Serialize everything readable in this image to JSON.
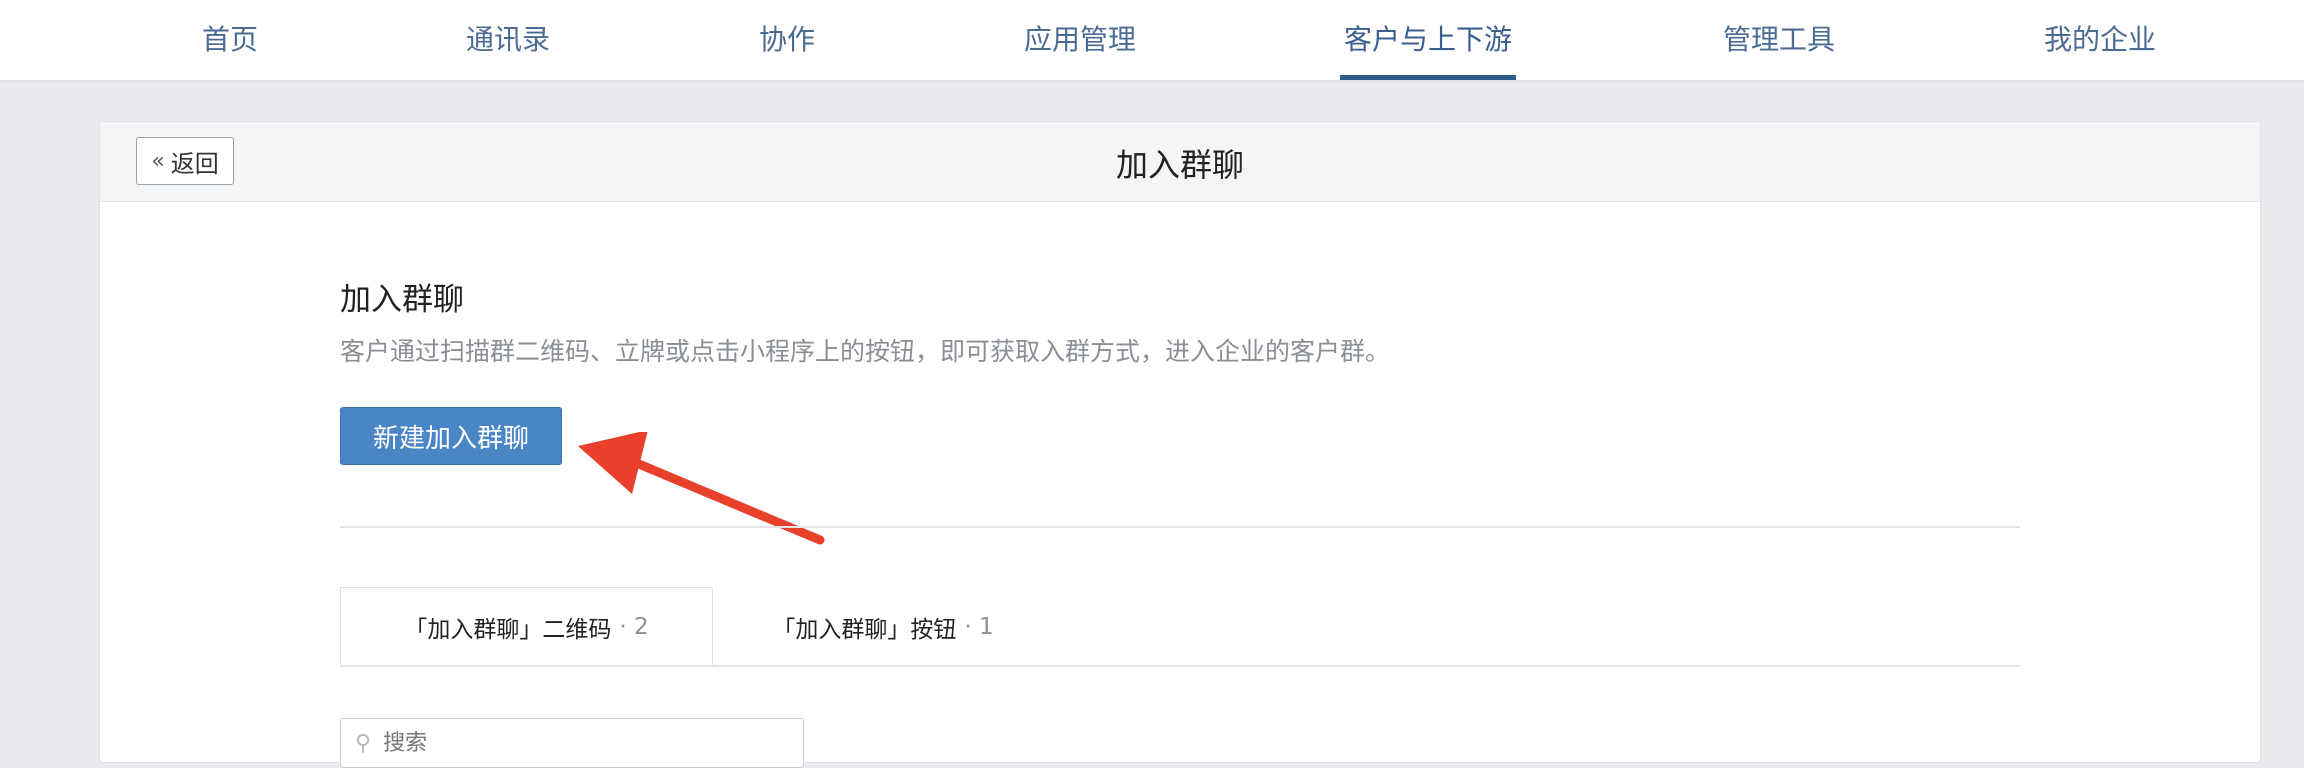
{
  "nav": {
    "items": [
      {
        "label": "首页"
      },
      {
        "label": "通讯录"
      },
      {
        "label": "协作"
      },
      {
        "label": "应用管理"
      },
      {
        "label": "客户与上下游"
      },
      {
        "label": "管理工具"
      },
      {
        "label": "我的企业"
      }
    ],
    "active_index": 4
  },
  "page": {
    "back_label": "返回",
    "back_icon": "double-chevron-left-icon",
    "title": "加入群聊"
  },
  "section": {
    "title": "加入群聊",
    "description": "客户通过扫描群二维码、立牌或点击小程序上的按钮，即可获取入群方式，进入企业的客户群。",
    "create_button": "新建加入群聊"
  },
  "tabs": [
    {
      "label": "「加入群聊」二维码",
      "count": "· 2"
    },
    {
      "label": "「加入群聊」按钮",
      "count": "· 1"
    }
  ],
  "search": {
    "placeholder": "搜索",
    "icon": "search-icon"
  },
  "colors": {
    "accent": "#2f5b8c",
    "primary_button": "#4a86c6",
    "annotation_arrow": "#e8402a"
  }
}
